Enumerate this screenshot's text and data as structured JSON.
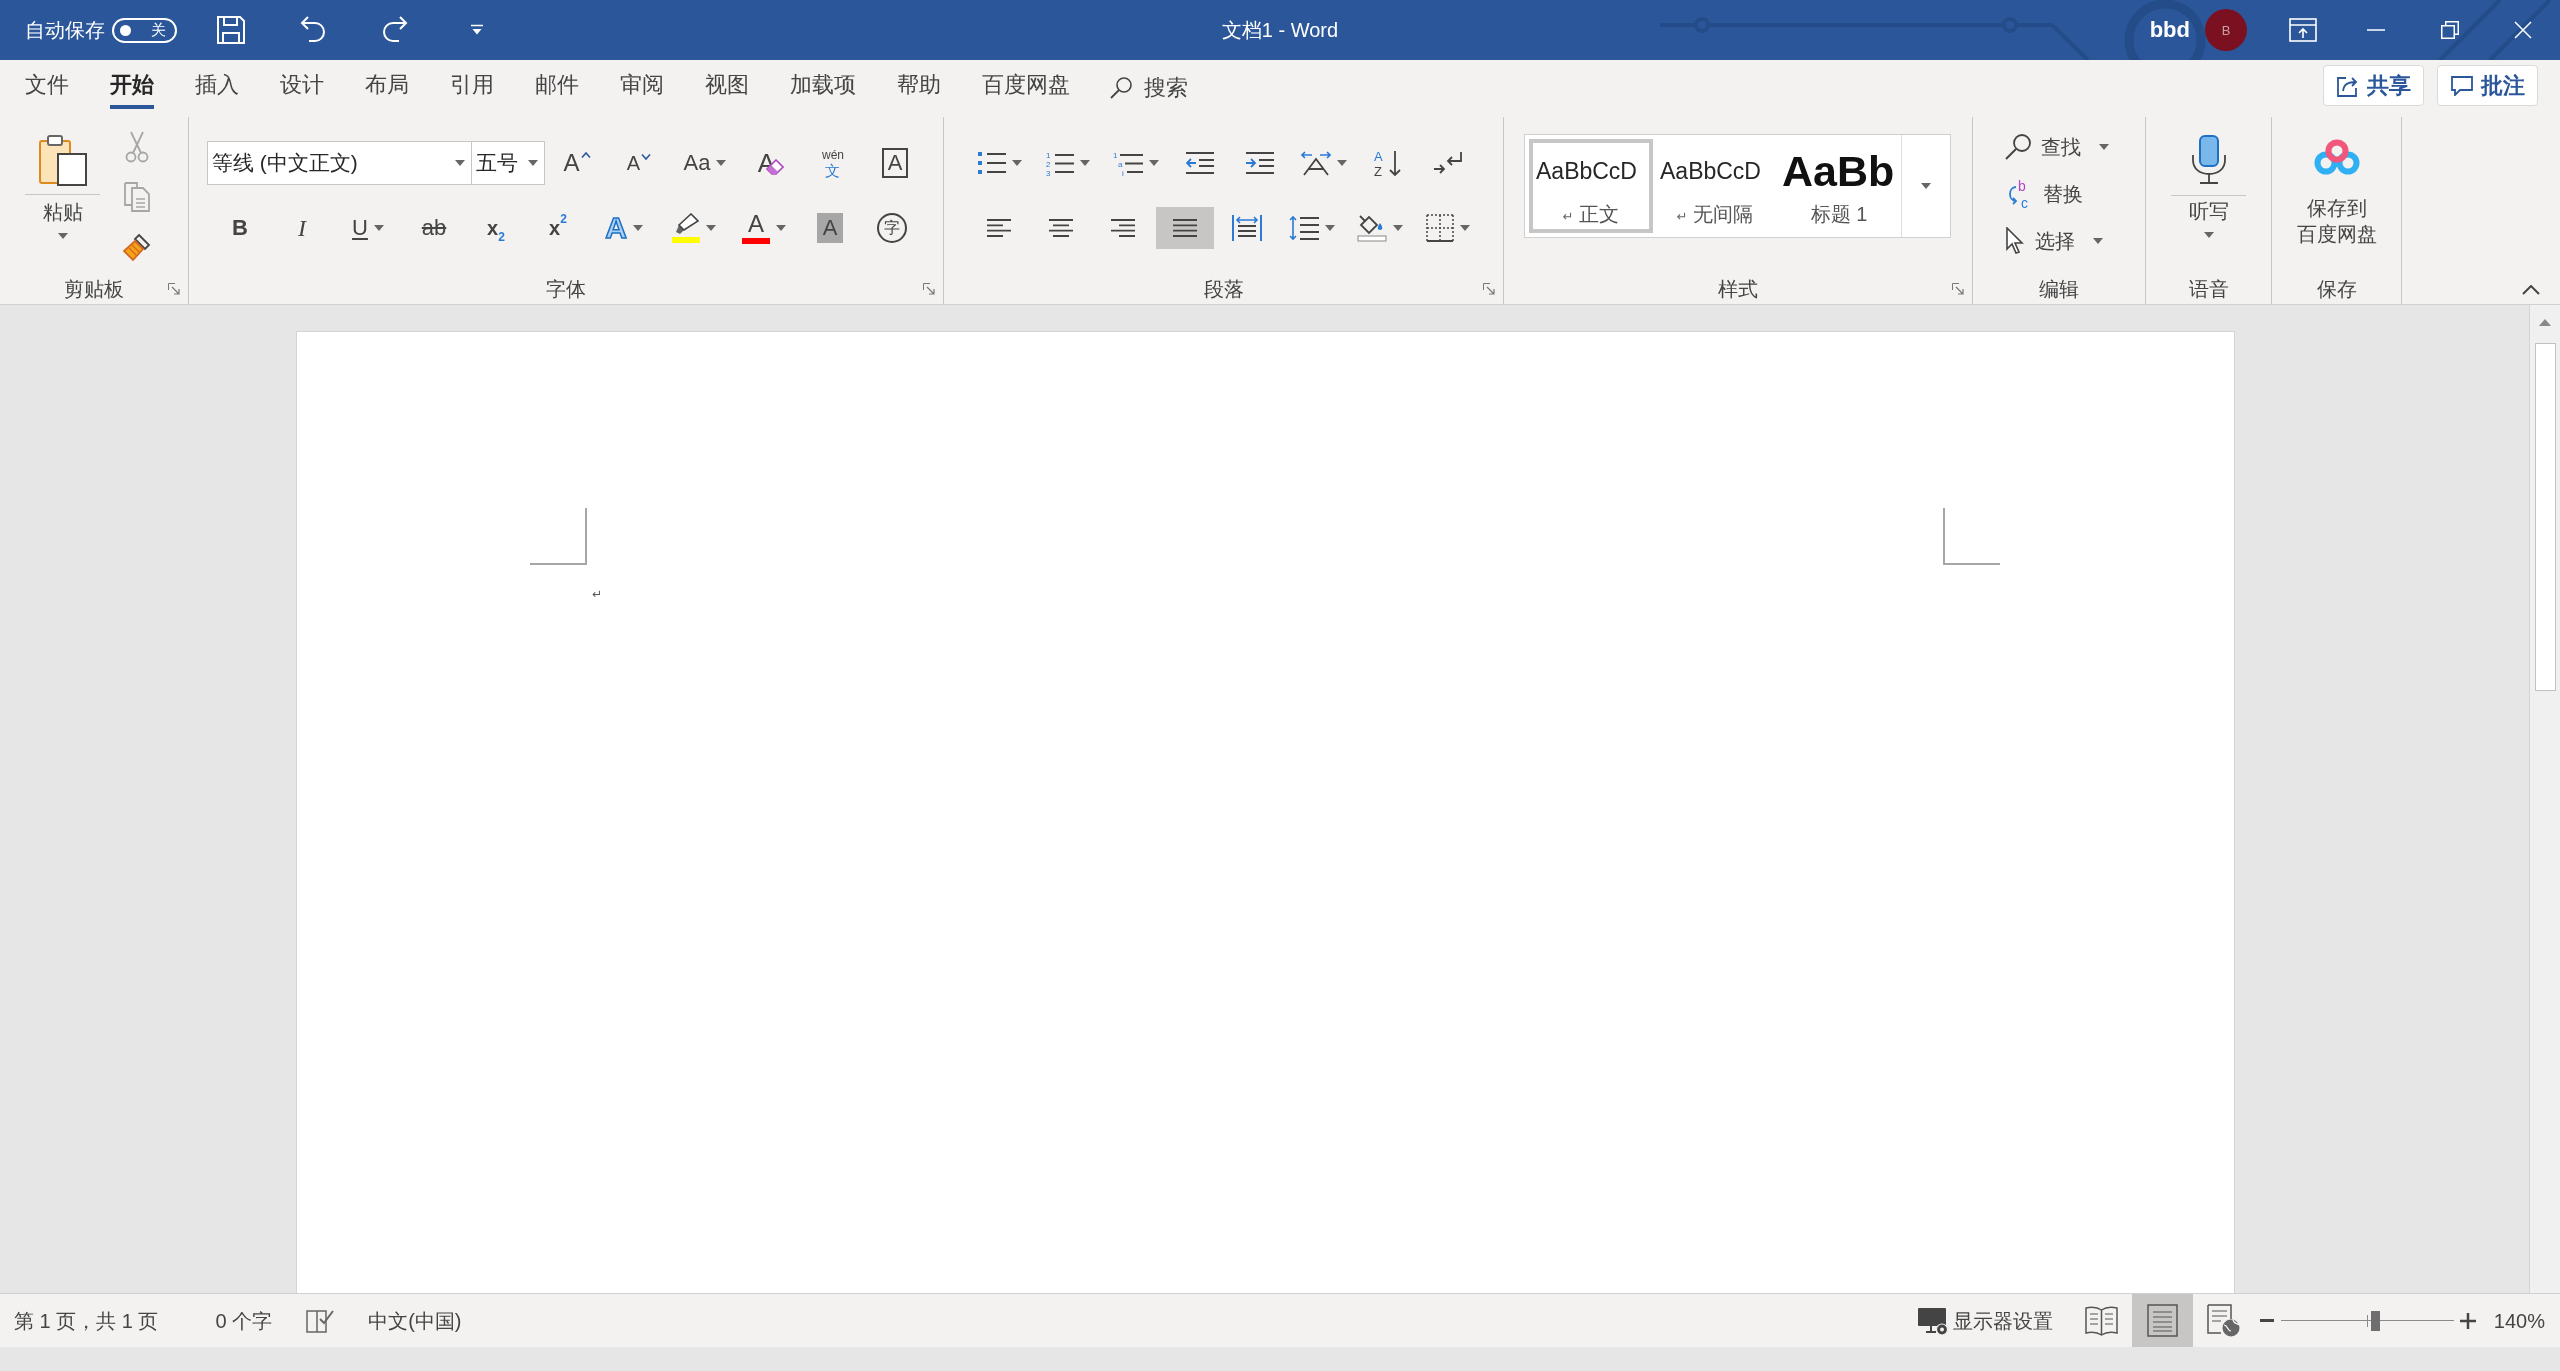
{
  "title_bar": {
    "autosave": {
      "label": "自动保存",
      "on": false,
      "state_label": "关"
    },
    "title": "文档1 - Word",
    "user": {
      "name": "bbd",
      "initial": "B"
    }
  },
  "tabs": [
    {
      "label": "文件",
      "selected": false
    },
    {
      "label": "开始",
      "selected": true
    },
    {
      "label": "插入",
      "selected": false
    },
    {
      "label": "设计",
      "selected": false
    },
    {
      "label": "布局",
      "selected": false
    },
    {
      "label": "引用",
      "selected": false
    },
    {
      "label": "邮件",
      "selected": false
    },
    {
      "label": "审阅",
      "selected": false
    },
    {
      "label": "视图",
      "selected": false
    },
    {
      "label": "加载项",
      "selected": false
    },
    {
      "label": "帮助",
      "selected": false
    },
    {
      "label": "百度网盘",
      "selected": false
    }
  ],
  "search": {
    "label": "搜索"
  },
  "actions": [
    {
      "kind": "share",
      "label": "共享"
    },
    {
      "kind": "comments",
      "label": "批注"
    }
  ],
  "ribbon": {
    "clipboard": {
      "label": "剪贴板",
      "paste": {
        "label": "粘贴"
      },
      "tools": [
        {
          "kind": "cut",
          "disabled": true
        },
        {
          "kind": "copy",
          "disabled": true
        },
        {
          "kind": "format_painter",
          "disabled": false
        }
      ]
    },
    "font": {
      "label": "字体",
      "font_name": "等线 (中文正文)",
      "font_size": "五号",
      "row_1": [
        {
          "kind": "grow",
          "glyphs": [
            "A"
          ],
          "dropdown": false
        },
        {
          "kind": "shrink",
          "glyphs": [
            "A"
          ],
          "dropdown": false
        },
        {
          "kind": "change_case",
          "glyphs": [
            "Aa"
          ],
          "dropdown": true
        },
        {
          "kind": "clear_format",
          "glyphs": [
            "A"
          ],
          "dropdown": false
        },
        {
          "kind": "phonetic",
          "glyphs": [
            "wén",
            "文"
          ],
          "dropdown": false
        },
        {
          "kind": "char_border",
          "glyphs": [
            "A"
          ],
          "dropdown": false
        }
      ],
      "row_2": [
        {
          "kind": "bold",
          "glyphs": [
            "B"
          ],
          "dropdown": false
        },
        {
          "kind": "italic",
          "glyphs": [
            "I"
          ],
          "dropdown": false
        },
        {
          "kind": "underline",
          "glyphs": [
            "U"
          ],
          "dropdown": true
        },
        {
          "kind": "strike",
          "glyphs": [
            "ab"
          ],
          "dropdown": false
        },
        {
          "kind": "subscript",
          "glyphs": [
            "x",
            "2"
          ],
          "dropdown": false
        },
        {
          "kind": "superscript",
          "glyphs": [
            "x",
            "2"
          ],
          "dropdown": false
        },
        {
          "kind": "text_effect",
          "glyphs": [
            "A"
          ],
          "dropdown": true
        },
        {
          "kind": "highlight",
          "color": "#ffff00",
          "dropdown": true
        },
        {
          "kind": "font_color",
          "glyphs": [
            "A"
          ],
          "color": "#ff0000",
          "dropdown": true
        },
        {
          "kind": "shading",
          "glyphs": [
            "A"
          ],
          "dropdown": false
        },
        {
          "kind": "enclose",
          "glyphs": [
            "字"
          ],
          "dropdown": false
        }
      ]
    },
    "paragraph": {
      "label": "段落",
      "row_1": [
        {
          "kind": "bullets",
          "dropdown": true
        },
        {
          "kind": "numbering",
          "glyphs": [
            "1",
            "2",
            "3"
          ],
          "dropdown": true
        },
        {
          "kind": "multilevel",
          "glyphs": [
            "1",
            "a",
            "i"
          ],
          "dropdown": true
        },
        {
          "kind": "outdent",
          "dropdown": false
        },
        {
          "kind": "indent",
          "dropdown": false
        },
        {
          "kind": "asian_layout",
          "dropdown": true
        },
        {
          "kind": "sort",
          "glyphs": [
            "A",
            "Z"
          ],
          "dropdown": false
        },
        {
          "kind": "show_marks",
          "dropdown": false
        }
      ],
      "row_2": [
        {
          "kind": "align_left",
          "selected": false,
          "dropdown": false
        },
        {
          "kind": "align_center",
          "selected": false,
          "dropdown": false
        },
        {
          "kind": "align_right",
          "selected": false,
          "dropdown": false
        },
        {
          "kind": "justify",
          "selected": true,
          "dropdown": false
        },
        {
          "kind": "distribute",
          "selected": false,
          "dropdown": false
        },
        {
          "kind": "line_spacing",
          "selected": false,
          "dropdown": true
        },
        {
          "kind": "fill_shading",
          "selected": false,
          "dropdown": true
        },
        {
          "kind": "borders",
          "selected": false,
          "dropdown": true
        }
      ]
    },
    "styles": {
      "label": "样式",
      "items": [
        {
          "kind": "body",
          "preview": "AaBbCcD",
          "mark": "↵",
          "name": "正文",
          "selected": true
        },
        {
          "kind": "body",
          "preview": "AaBbCcD",
          "mark": "↵",
          "name": "无间隔",
          "selected": false
        },
        {
          "kind": "heading",
          "preview": "AaBb",
          "name": "标题 1",
          "selected": false
        }
      ]
    },
    "editing": {
      "label": "编辑",
      "items": [
        {
          "kind": "find",
          "label": "查找",
          "dropdown": true
        },
        {
          "kind": "replace",
          "label": "替换",
          "glyphs": [
            "b",
            "c"
          ],
          "dropdown": false
        },
        {
          "kind": "select",
          "label": "选择",
          "dropdown": true
        }
      ]
    },
    "voice": {
      "label": "语音",
      "dictate": {
        "label": "听写"
      }
    },
    "save": {
      "label": "保存",
      "save_to_cloud": {
        "lines": [
          "保存到",
          "百度网盘"
        ]
      }
    }
  },
  "document": {
    "paragraph_mark": "↵"
  },
  "status_bar": {
    "page": "第 1 页，共 1 页",
    "words": "0 个字",
    "language": "中文(中国)",
    "display_settings": "显示器设置",
    "views": [
      {
        "kind": "read",
        "selected": false
      },
      {
        "kind": "print",
        "selected": true
      },
      {
        "kind": "web",
        "selected": false
      }
    ],
    "zoom": {
      "level": 0.55,
      "reading": "140%"
    }
  }
}
